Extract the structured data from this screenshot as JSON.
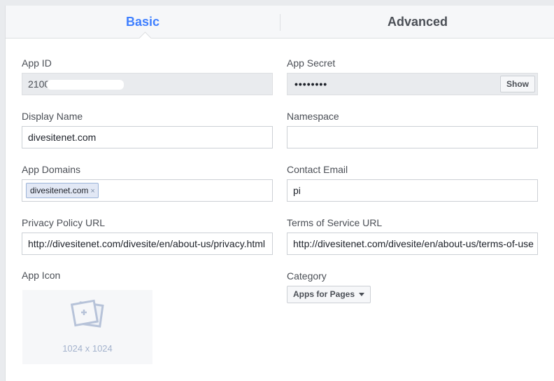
{
  "tabs": {
    "basic": "Basic",
    "advanced": "Advanced"
  },
  "fields": {
    "app_id": {
      "label": "App ID",
      "value": "2100"
    },
    "app_secret": {
      "label": "App Secret",
      "value": "••••••••",
      "show_label": "Show"
    },
    "display_name": {
      "label": "Display Name",
      "value": "divesitenet.com"
    },
    "namespace": {
      "label": "Namespace",
      "value": ""
    },
    "app_domains": {
      "label": "App Domains",
      "token": "divesitenet.com",
      "remove_glyph": "×"
    },
    "contact_email": {
      "label": "Contact Email",
      "value": "pi"
    },
    "privacy_url": {
      "label": "Privacy Policy URL",
      "value": "http://divesitenet.com/divesite/en/about-us/privacy.html"
    },
    "tos_url": {
      "label": "Terms of Service URL",
      "value": "http://divesitenet.com/divesite/en/about-us/terms-of-use"
    },
    "app_icon": {
      "label": "App Icon",
      "size_text": "1024 x 1024"
    },
    "category": {
      "label": "Category",
      "value": "Apps for Pages"
    }
  },
  "colors": {
    "accent": "#4080ff",
    "background": "#e9ebee"
  }
}
